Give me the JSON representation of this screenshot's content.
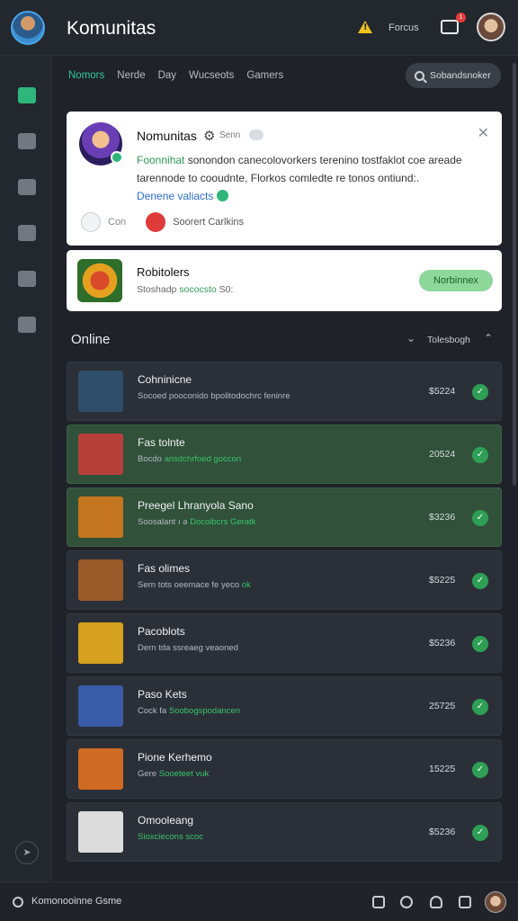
{
  "app": {
    "title": "Komunitas",
    "top_link": "Forcus",
    "msg_badge": "1"
  },
  "tabs": [
    "Nomors",
    "Nerde",
    "Day",
    "Wucseots",
    "Gamers"
  ],
  "search": {
    "placeholder": "Sobandsnoker"
  },
  "card1": {
    "title": "Nomunitas",
    "meta": "Senn",
    "body_highlight": "Foonnihat",
    "body": "sonondon canecolovorkers terenino tostfaklot coe areade tarennode to cooudnte, Florkos comledte re tonos ontiund:.",
    "link": "Denene valiacts",
    "foot_label": "Con",
    "foot_stream": "Soorert Carlkins"
  },
  "card2": {
    "title": "Robitolers",
    "sub": "Stoshadp",
    "sub_highlight": "sococsto",
    "sub_tail": "S0:",
    "button": "Norbinnex"
  },
  "online": {
    "title": "Online",
    "label": "Tolesbogh"
  },
  "rows": [
    {
      "title": "Cohninicne",
      "sub": "Socoed pooconido bpolitodochrc feninre",
      "sub_hl": "",
      "value": "$5224",
      "green": false,
      "thumb": "#2e4d6b"
    },
    {
      "title": "Fas tolnte",
      "sub": "Bocdo",
      "sub_hl": "arisdchrfoed goccon",
      "value": "20524",
      "green": true,
      "thumb": "#b5403a"
    },
    {
      "title": "Preegel Lhranyola Sano",
      "sub": "Soosalant ı ǝ",
      "sub_hl": "Docoibcrs Geratk",
      "value": "$3236",
      "green": true,
      "thumb": "#c4751f"
    },
    {
      "title": "Fas olimes",
      "sub": "Sern tots oeemace fe yeco",
      "sub_hl": "ok",
      "value": "$5225",
      "green": false,
      "thumb": "#9a5a2a"
    },
    {
      "title": "Pacoblots",
      "sub": "Dern tda ssreaeg veaoned",
      "sub_hl": "",
      "value": "$5236",
      "green": false,
      "thumb": "#d5a11e"
    },
    {
      "title": "Paso Kets",
      "sub": "Cock fa",
      "sub_hl": "Soobogspodancen",
      "value": "25725",
      "green": false,
      "thumb": "#3a5ba8"
    },
    {
      "title": "Pione Kerhemo",
      "sub": "Gere",
      "sub_hl": "Sooeteet vuk",
      "value": "15225",
      "green": false,
      "thumb": "#cf6a24"
    },
    {
      "title": "Omooleang",
      "sub": "",
      "sub_hl": "Sioxciecons scoc",
      "value": "$5236",
      "green": false,
      "thumb": "#dcdcdc"
    }
  ],
  "bottom": {
    "label": "Komonooinne Gsme"
  }
}
